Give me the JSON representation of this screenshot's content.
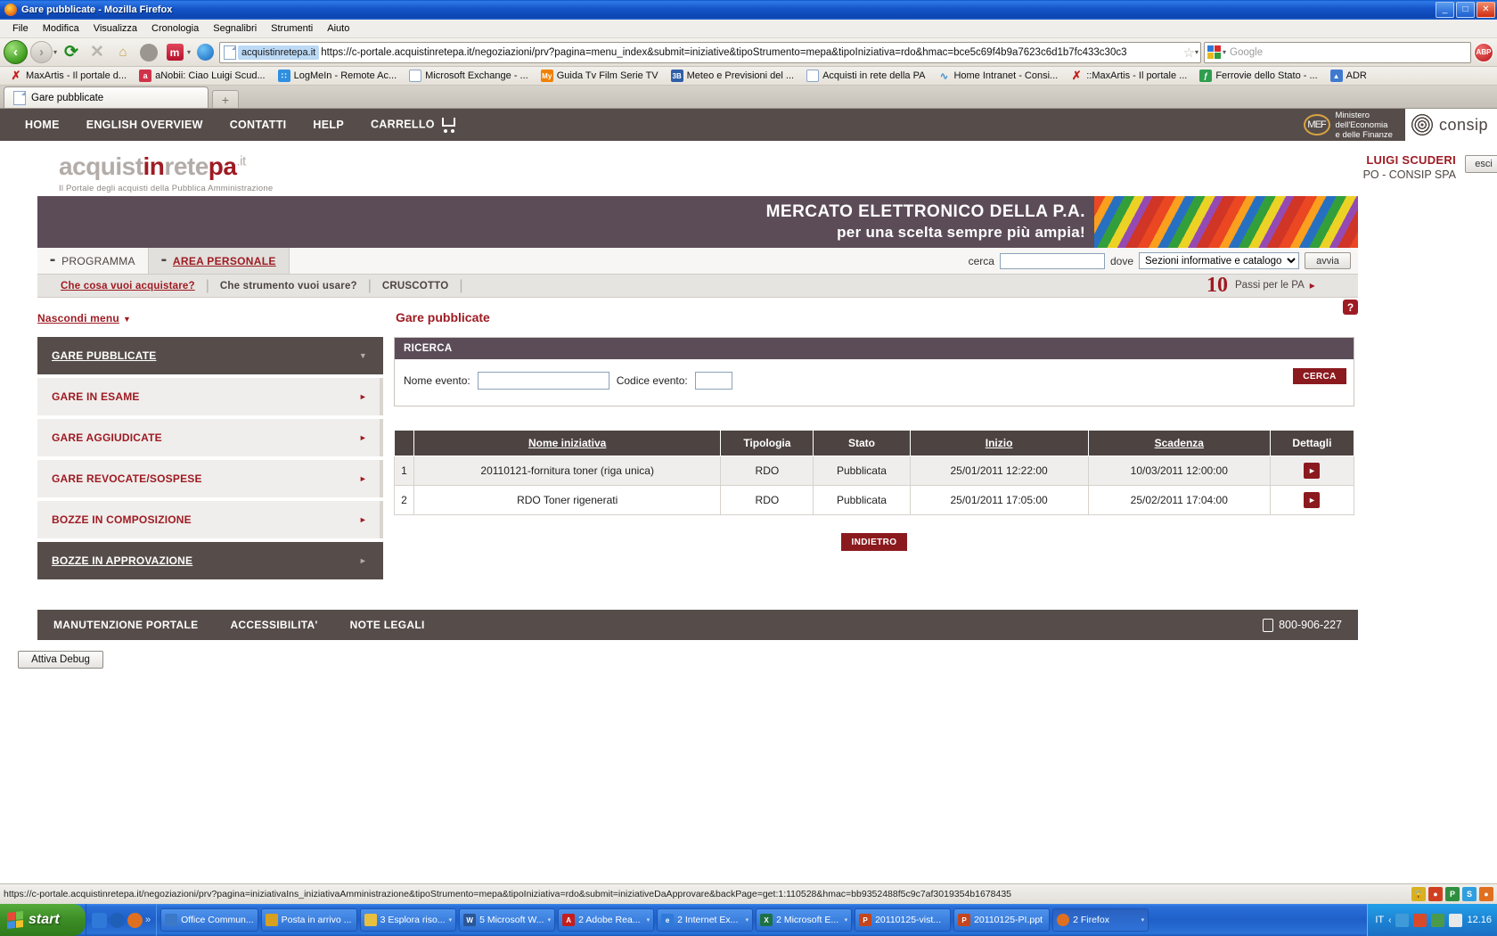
{
  "window": {
    "title": "Gare pubblicate - Mozilla Firefox",
    "minimize": "_",
    "maximize": "□",
    "close": "✕"
  },
  "menubar": [
    "File",
    "Modifica",
    "Visualizza",
    "Cronologia",
    "Segnalibri",
    "Strumenti",
    "Aiuto"
  ],
  "navbar": {
    "back": "‹",
    "forward": "›",
    "reload": "⟳",
    "stop": "✕",
    "home": "⌂",
    "m_button": "m",
    "url_domain": "acquistinretepa.it",
    "url": "https://c-portale.acquistinretepa.it/negoziazioni/prv?pagina=menu_index&submit=iniziative&tipoStrumento=mepa&tipoIniziativa=rdo&hmac=bce5c69f4b9a7623c6d1b7fc433c30c3",
    "star": "☆",
    "search_placeholder": "Google",
    "abp": "ABP"
  },
  "bookmarks": [
    {
      "label": "MaxArtis - Il portale d...",
      "icon": "maxartis-icon"
    },
    {
      "label": "aNobii: Ciao Luigi Scud...",
      "icon": "anobii-icon"
    },
    {
      "label": "LogMeIn - Remote Ac...",
      "icon": "logmein-icon"
    },
    {
      "label": "Microsoft Exchange - ...",
      "icon": "page-icon"
    },
    {
      "label": "Guida Tv Film Serie TV",
      "icon": "my-icon"
    },
    {
      "label": "Meteo e Previsioni del ...",
      "icon": "meteo-icon"
    },
    {
      "label": "Acquisti in rete della PA",
      "icon": "page-icon"
    },
    {
      "label": "Home Intranet - Consi...",
      "icon": "intranet-icon"
    },
    {
      "label": "::MaxArtis - Il portale ...",
      "icon": "maxartis-icon"
    },
    {
      "label": "Ferrovie dello Stato - ...",
      "icon": "fs-icon"
    },
    {
      "label": "ADR",
      "icon": "adr-icon"
    }
  ],
  "browser_tab": {
    "title": "Gare pubblicate",
    "new_tab": "+"
  },
  "topnav": {
    "items": [
      "HOME",
      "ENGLISH OVERVIEW",
      "CONTATTI",
      "HELP",
      "CARRELLO"
    ],
    "mef": {
      "mark": "MEF",
      "line1": "Ministero",
      "line2": "dell'Economia",
      "line3": "e delle Finanze"
    },
    "consip": "consip"
  },
  "brand": {
    "logo_a": "acquist",
    "logo_in": "in",
    "logo_rete": "rete",
    "logo_pa": "pa",
    "logo_it": ".it",
    "tagline": "Il Portale degli acquisti della Pubblica Amministrazione",
    "user_name": "LUIGI SCUDERI",
    "user_org": "PO - CONSIP SPA",
    "logout": "esci"
  },
  "banner": {
    "line1": "MERCATO ELETTRONICO DELLA P.A.",
    "line2": "per una scelta sempre più ampia!"
  },
  "tabsrow": {
    "tabs": [
      {
        "label": "PROGRAMMA",
        "active": false
      },
      {
        "label": "AREA PERSONALE",
        "active": true
      }
    ],
    "search_label": "cerca",
    "search_value": "",
    "where_label": "dove",
    "where_selected": "Sezioni informative e catalogo",
    "start_button": "avvia"
  },
  "subnav": {
    "items": [
      "Che cosa vuoi acquistare?",
      "Che strumento vuoi usare?",
      "CRUSCOTTO"
    ],
    "separator": "|",
    "passi_number": "10",
    "passi_text": "Passi per le PA",
    "passi_arrow": "▸"
  },
  "sidebar": {
    "hide_menu": "Nascondi menu",
    "hide_menu_caret": "▼",
    "items": [
      {
        "label": "GARE PUBBLICATE",
        "state": "dark",
        "caret": "▼"
      },
      {
        "label": "GARE IN ESAME",
        "state": "light",
        "caret": "►"
      },
      {
        "label": "GARE AGGIUDICATE",
        "state": "light",
        "caret": "►"
      },
      {
        "label": "GARE REVOCATE/SOSPESE",
        "state": "light",
        "caret": "►"
      },
      {
        "label": "BOZZE IN COMPOSIZIONE",
        "state": "light",
        "caret": "►"
      },
      {
        "label": "BOZZE IN APPROVAZIONE",
        "state": "dark",
        "caret": "►"
      }
    ]
  },
  "main": {
    "page_title": "Gare pubblicate",
    "help_icon": "?",
    "search_panel": {
      "heading": "RICERCA",
      "nome_label": "Nome evento:",
      "nome_value": "",
      "codice_label": "Codice evento:",
      "codice_value": "",
      "search_button": "CERCA"
    },
    "table": {
      "headers": [
        "",
        "Nome iniziativa",
        "Tipologia",
        "Stato",
        "Inizio",
        "Scadenza",
        "Dettagli"
      ],
      "rows": [
        {
          "index": "1",
          "nome": "20110121-fornitura toner (riga unica)",
          "tipologia": "RDO",
          "stato": "Pubblicata",
          "inizio": "25/01/2011 12:22:00",
          "scadenza": "10/03/2011 12:00:00",
          "dettagli": "►"
        },
        {
          "index": "2",
          "nome": "RDO Toner rigenerati",
          "tipologia": "RDO",
          "stato": "Pubblicata",
          "inizio": "25/01/2011 17:05:00",
          "scadenza": "25/02/2011 17:04:00",
          "dettagli": "►"
        }
      ]
    },
    "back_button": "INDIETRO"
  },
  "footer": {
    "links": [
      "MANUTENZIONE PORTALE",
      "ACCESSIBILITA'",
      "NOTE LEGALI"
    ],
    "phone": "800-906-227"
  },
  "debug_button": "Attiva Debug",
  "statusbar": {
    "url": "https://c-portale.acquistinretepa.it/negoziazioni/prv?pagina=iniziativaIns_iniziativaAmministrazione&tipoStrumento=mepa&tipoIniziativa=rdo&submit=iniziativeDaApprovare&backPage=get:1:110528&hmac=bb9352488f5c9c7af3019354b1678435"
  },
  "taskbar": {
    "start": "start",
    "tasks": [
      {
        "label": "Office Commun...",
        "icon": "office-communicator-icon",
        "color": "#3b78c8"
      },
      {
        "label": "Posta in arrivo ...",
        "icon": "outlook-icon",
        "color": "#d8a020"
      },
      {
        "label": "3 Esplora riso...",
        "icon": "explorer-icon",
        "color": "#e8c040"
      },
      {
        "label": "5 Microsoft W...",
        "icon": "word-icon",
        "color": "#2b5797"
      },
      {
        "label": "2 Adobe Rea...",
        "icon": "adobe-icon",
        "color": "#c41e1e"
      },
      {
        "label": "2 Internet Ex...",
        "icon": "ie-icon",
        "color": "#2f7ad8"
      },
      {
        "label": "2 Microsoft E...",
        "icon": "excel-icon",
        "color": "#1e7145"
      },
      {
        "label": "20110125-vist...",
        "icon": "powerpoint-icon",
        "color": "#c4461e"
      },
      {
        "label": "20110125-PI.ppt",
        "icon": "powerpoint-icon",
        "color": "#c4461e"
      },
      {
        "label": "2 Firefox",
        "icon": "firefox-icon",
        "color": "#e07020"
      }
    ],
    "language": "IT",
    "clock": "12.16"
  }
}
